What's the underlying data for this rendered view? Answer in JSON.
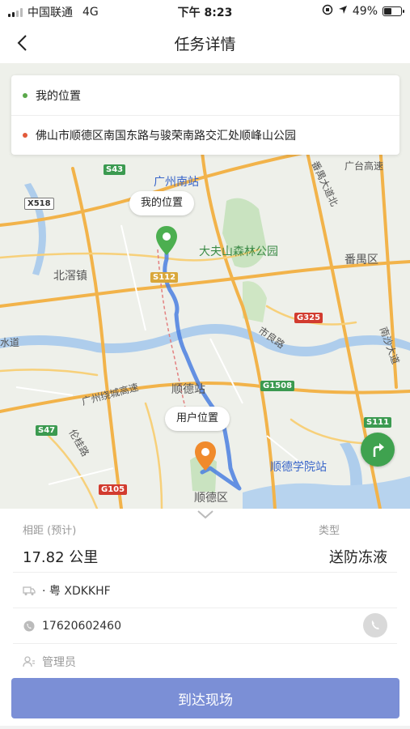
{
  "status_bar": {
    "carrier": "中国联通",
    "network": "4G",
    "time": "下午 8:23",
    "battery_percent": "49%",
    "battery_level": 0.49
  },
  "header": {
    "title": "任务详情"
  },
  "route": {
    "origin_label": "我的位置",
    "destination_label": "佛山市顺德区南国东路与骏荣南路交汇处顺峰山公园",
    "origin_color": "#5aa84a",
    "destination_color": "#e25a3a"
  },
  "map": {
    "bubble_my_location": "我的位置",
    "bubble_user_location": "用户位置",
    "places": {
      "guangzhou_south": "广州南站",
      "dafushan": "大夫山森林公园",
      "beijiao": "北滘镇",
      "panyu": "番禺区",
      "shiliang_road": "市良路",
      "shunde_station": "顺德站",
      "shunde_college": "顺德学院站",
      "shunde_district": "顺德区",
      "guangzhou_ring": "广州绕城高速",
      "lungui_road": "伦桂路",
      "nansha_ave": "南沙大道",
      "guangtai_hwy": "广台高速",
      "panyu_ave": "番禺大道北",
      "water_road": "水道"
    },
    "shields": {
      "s43": "S43",
      "x518": "X518",
      "s112": "S112",
      "g325": "G325",
      "g1508": "G1508",
      "s111": "S111",
      "s47": "S47",
      "g105": "G105"
    },
    "route_color": "#4a7fe0",
    "nav_icon": "turn-right-icon"
  },
  "details": {
    "distance_label": "相距 (预计)",
    "distance_value": "17.82 公里",
    "type_label": "类型",
    "type_value": "送防冻液",
    "plate": "· 粤 XDKKHF",
    "phone": "17620602460",
    "role": "管理员",
    "action_button": "到达现场",
    "action_color": "#7b8fd6"
  }
}
